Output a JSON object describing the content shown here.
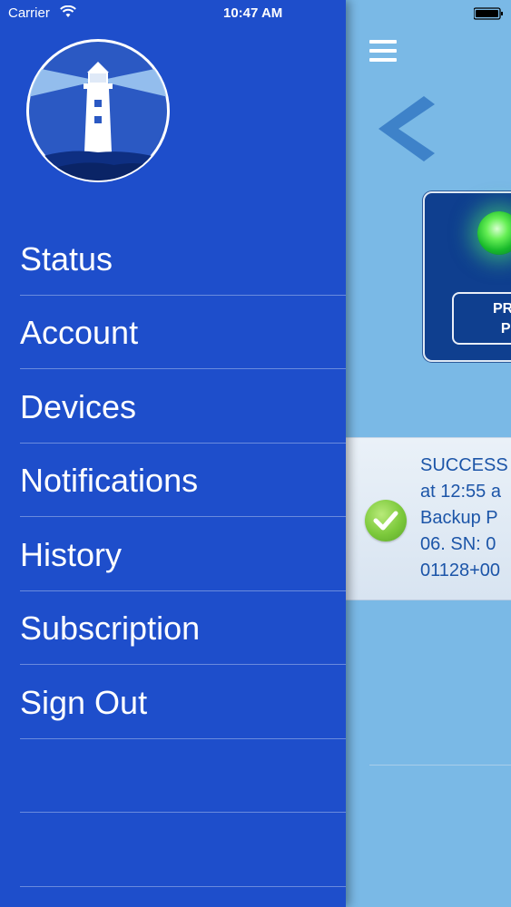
{
  "status_bar": {
    "carrier": "Carrier",
    "time": "10:47 AM",
    "battery": "full"
  },
  "drawer": {
    "logo": "lighthouse-logo",
    "menu": [
      {
        "label": "Status"
      },
      {
        "label": "Account"
      },
      {
        "label": "Devices"
      },
      {
        "label": "Notifications"
      },
      {
        "label": "History"
      },
      {
        "label": "Subscription"
      },
      {
        "label": "Sign Out"
      }
    ]
  },
  "main": {
    "pump_card": {
      "label_line1": "PRIM",
      "label_line2": "PU",
      "indicator_color": "#3fe35a"
    },
    "notification": {
      "lines": [
        "SUCCESS",
        "at 12:55 a",
        "Backup P",
        "06. SN: 0",
        "01128+00"
      ],
      "icon": "check-circle-icon"
    }
  },
  "colors": {
    "drawer_bg": "#1e4ecb",
    "main_bg": "#7ab9e6",
    "card_bg": "#0f3f8f",
    "success_green": "#7cc93b",
    "notif_text": "#1c55a8"
  }
}
